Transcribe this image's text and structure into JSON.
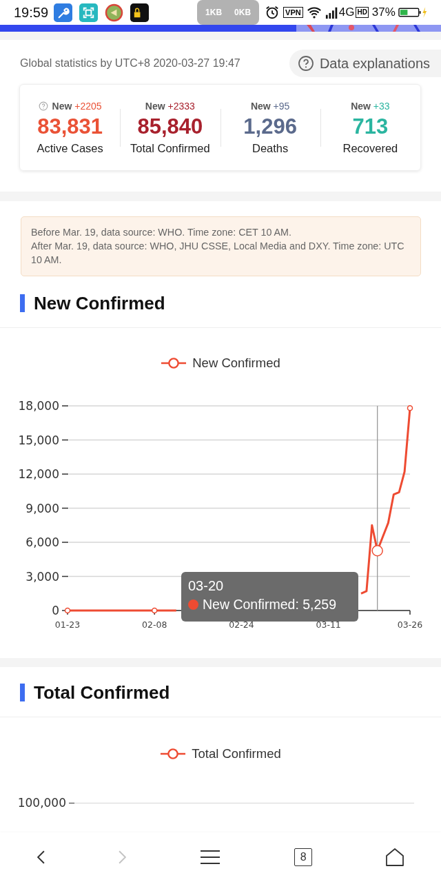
{
  "status_bar": {
    "time": "19:59",
    "upload": "1KB",
    "download": "0KB",
    "vpn_label": "VPN",
    "network": "4G",
    "hd_label": "HD",
    "battery": "37%"
  },
  "header": {
    "stats_time": "Global statistics by UTC+8 2020-03-27 19:47",
    "explanations_button": "Data explanations"
  },
  "stats": [
    {
      "new_label": "New",
      "delta": "+2205",
      "value": "83,831",
      "label": "Active Cases",
      "color": "#ea5236",
      "help": true
    },
    {
      "new_label": "New",
      "delta": "+2333",
      "value": "85,840",
      "label": "Total Confirmed",
      "color": "#a8212d",
      "help": false
    },
    {
      "new_label": "New",
      "delta": "+95",
      "value": "1,296",
      "label": "Deaths",
      "color": "#5b6a8c",
      "help": false
    },
    {
      "new_label": "New",
      "delta": "+33",
      "value": "713",
      "label": "Recovered",
      "color": "#2bb5a0",
      "help": false
    }
  ],
  "notice": [
    "Before Mar. 19, data source: WHO. Time zone: CET 10 AM.",
    "After Mar. 19, data source: WHO, JHU CSSE, Local Media and DXY. Time zone: UTC 10 AM."
  ],
  "new_confirmed": {
    "title": "New Confirmed",
    "tooltip": {
      "date": "03-20",
      "text": "New Confirmed: 5,259"
    },
    "chart_data": {
      "type": "line",
      "categories": [
        "01-23",
        null,
        null,
        null,
        null,
        null,
        null,
        null,
        null,
        null,
        null,
        null,
        null,
        null,
        null,
        null,
        "02-08",
        null,
        null,
        null,
        null,
        null,
        null,
        null,
        null,
        null,
        null,
        null,
        null,
        null,
        null,
        null,
        "02-24",
        null,
        null,
        null,
        null,
        null,
        null,
        null,
        null,
        null,
        null,
        null,
        null,
        null,
        null,
        null,
        "03-11",
        null,
        null,
        null,
        null,
        null,
        null,
        null,
        null,
        null,
        null,
        null,
        null,
        null,
        null,
        "03-26"
      ],
      "series": [
        {
          "name": "New Confirmed",
          "color": "#ee4b32",
          "values": [
            0,
            0,
            0,
            0,
            0,
            0,
            0,
            0,
            0,
            0,
            0,
            0,
            0,
            0,
            0,
            0,
            0,
            0,
            0,
            0,
            0,
            null,
            null,
            null,
            null,
            null,
            null,
            null,
            null,
            null,
            null,
            null,
            null,
            null,
            null,
            null,
            null,
            null,
            null,
            null,
            null,
            null,
            null,
            null,
            null,
            null,
            null,
            null,
            null,
            null,
            null,
            null,
            null,
            null,
            1500,
            1700,
            7500,
            5259,
            6500,
            7700,
            10200,
            10400,
            12200,
            17800
          ]
        }
      ],
      "ylim": [
        0,
        18000
      ],
      "yticks": [
        {
          "value": 0,
          "label": "0"
        },
        {
          "value": 3000,
          "label": "3,000"
        },
        {
          "value": 6000,
          "label": "6,000"
        },
        {
          "value": 9000,
          "label": "9,000"
        },
        {
          "value": 12000,
          "label": "12,000"
        },
        {
          "value": 15000,
          "label": "15,000"
        },
        {
          "value": 18000,
          "label": "18,000"
        }
      ],
      "grid": true
    }
  },
  "total_confirmed": {
    "title": "Total Confirmed",
    "legend": "Total Confirmed",
    "y_tick_labels": [
      "100,000"
    ]
  },
  "nav_buttons": [
    {
      "kind": "back",
      "disabled": false
    },
    {
      "kind": "forward",
      "disabled": true
    },
    {
      "kind": "menu",
      "disabled": false
    },
    {
      "kind": "tabs",
      "label": "8",
      "disabled": false
    },
    {
      "kind": "home",
      "disabled": false
    }
  ]
}
